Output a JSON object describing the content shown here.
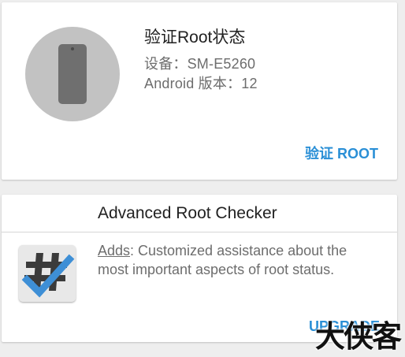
{
  "root_card": {
    "title": "验证Root状态",
    "device_line": "设备：SM-E5260",
    "android_line": "Android 版本：12",
    "verify_button": "验证 ROOT",
    "icon": "phone-icon"
  },
  "checker_card": {
    "title": "Advanced Root Checker",
    "adds_label": "Adds",
    "description": ": Customized assistance about the most important aspects of root status.",
    "upgrade_button": "UPGRADE",
    "icon": "root-checker-app-icon"
  },
  "watermark": {
    "text": "大侠客"
  },
  "colors": {
    "accent": "#2a8fd6",
    "background": "#eeeeee",
    "card": "#ffffff",
    "circle": "#c2c2c2",
    "phone": "#6f6f6f"
  }
}
